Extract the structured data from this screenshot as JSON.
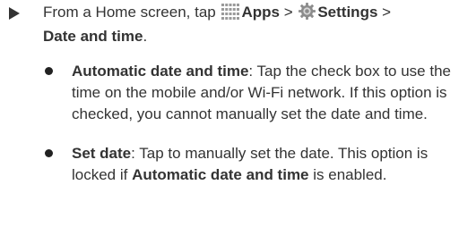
{
  "step": {
    "prefix": "From a Home screen, tap ",
    "apps_icon": "apps-grid-icon",
    "apps_label": "Apps",
    "separator_1": " > ",
    "settings_icon": "settings-gear-icon",
    "settings_label": "Settings",
    "separator_2": " >",
    "destination": "Date and time",
    "suffix": "."
  },
  "bullets": [
    {
      "term": "Automatic date and time",
      "text": ": Tap the check box to use the time on the mobile and/or Wi-Fi network. If this option is checked, you cannot manually set the date and time."
    },
    {
      "term": "Set date",
      "text_before": ": Tap to manually set the date. This option is locked if ",
      "inline_term": "Automatic date and time",
      "text_after": " is enabled."
    }
  ],
  "colors": {
    "text": "#333333",
    "icon": "#999999"
  }
}
